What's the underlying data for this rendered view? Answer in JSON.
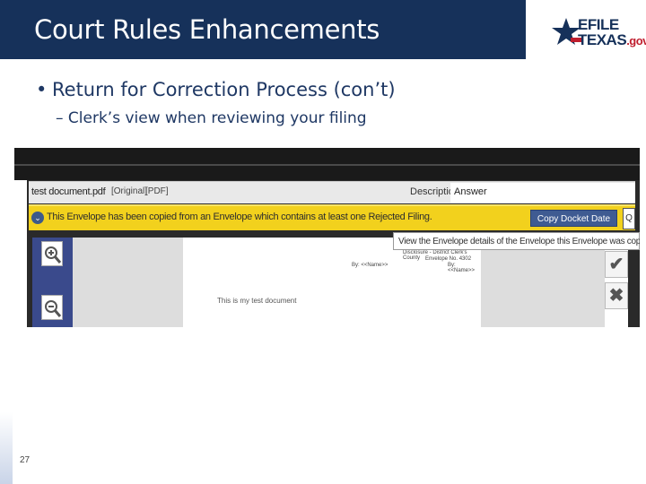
{
  "header": {
    "title": "Court Rules Enhancements",
    "logo": {
      "top": "EFILE",
      "bottom_main": "TEXAS",
      "bottom_suffix": ".gov",
      "icon": "texas-star-icon"
    }
  },
  "bullets": {
    "level1": "Return for Correction Process (con’t)",
    "level2": "– Clerk’s view when reviewing your filing"
  },
  "screenshot": {
    "filebar": {
      "filename": "test document.pdf",
      "tag_original": "[Original]",
      "tag_pdf": "[PDF]",
      "description_label": "Description",
      "description_value": "Answer"
    },
    "alert": {
      "icon": "chevron-down-icon",
      "text": "This Envelope has been copied from an Envelope which contains at least one Rejected Filing.",
      "copy_button": "Copy Docket Date",
      "view_button": "Q"
    },
    "tooltip": "View the Envelope details of the Envelope this Envelope was copied from",
    "document": {
      "header_line1": "Disclosure - District Clerk's County",
      "header_line2": "Envelope No. 4302",
      "by_left": "By: <<Name>>",
      "by_right": "By:<<Name>>",
      "body_text": "This is my test document"
    },
    "actions": {
      "accept": "✔",
      "reject": "✖"
    }
  },
  "footer": {
    "page_number": "27"
  },
  "colors": {
    "header_band": "#16315a",
    "alert_bar": "#f2d11d",
    "button": "#3f5b92",
    "logo_red": "#bf1e2e"
  }
}
